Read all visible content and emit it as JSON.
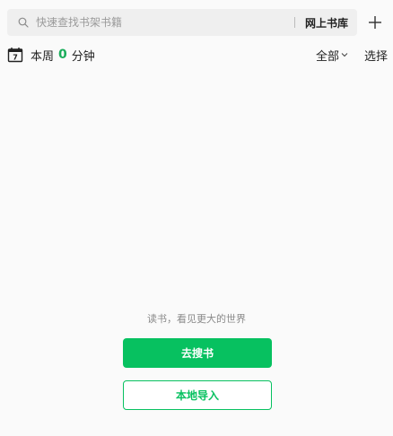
{
  "search": {
    "placeholder": "快速查找书架书籍",
    "value": "",
    "icon": "search-icon"
  },
  "header": {
    "online_store_label": "网上书库",
    "add_icon": "plus-icon"
  },
  "reading_stats": {
    "calendar_icon": "calendar-icon",
    "calendar_day": "7",
    "prefix": "本周",
    "minutes": "0",
    "unit": "分钟"
  },
  "filter": {
    "selected": "全部",
    "chevron_icon": "chevron-down-icon",
    "select_label": "选择"
  },
  "empty_state": {
    "message": "读书，看见更大的世界",
    "primary_button": "去搜书",
    "secondary_button": "本地导入"
  },
  "colors": {
    "accent": "#07c160",
    "highlight_number": "#1aad5b",
    "background": "#fafafa",
    "search_background": "#efefef"
  }
}
